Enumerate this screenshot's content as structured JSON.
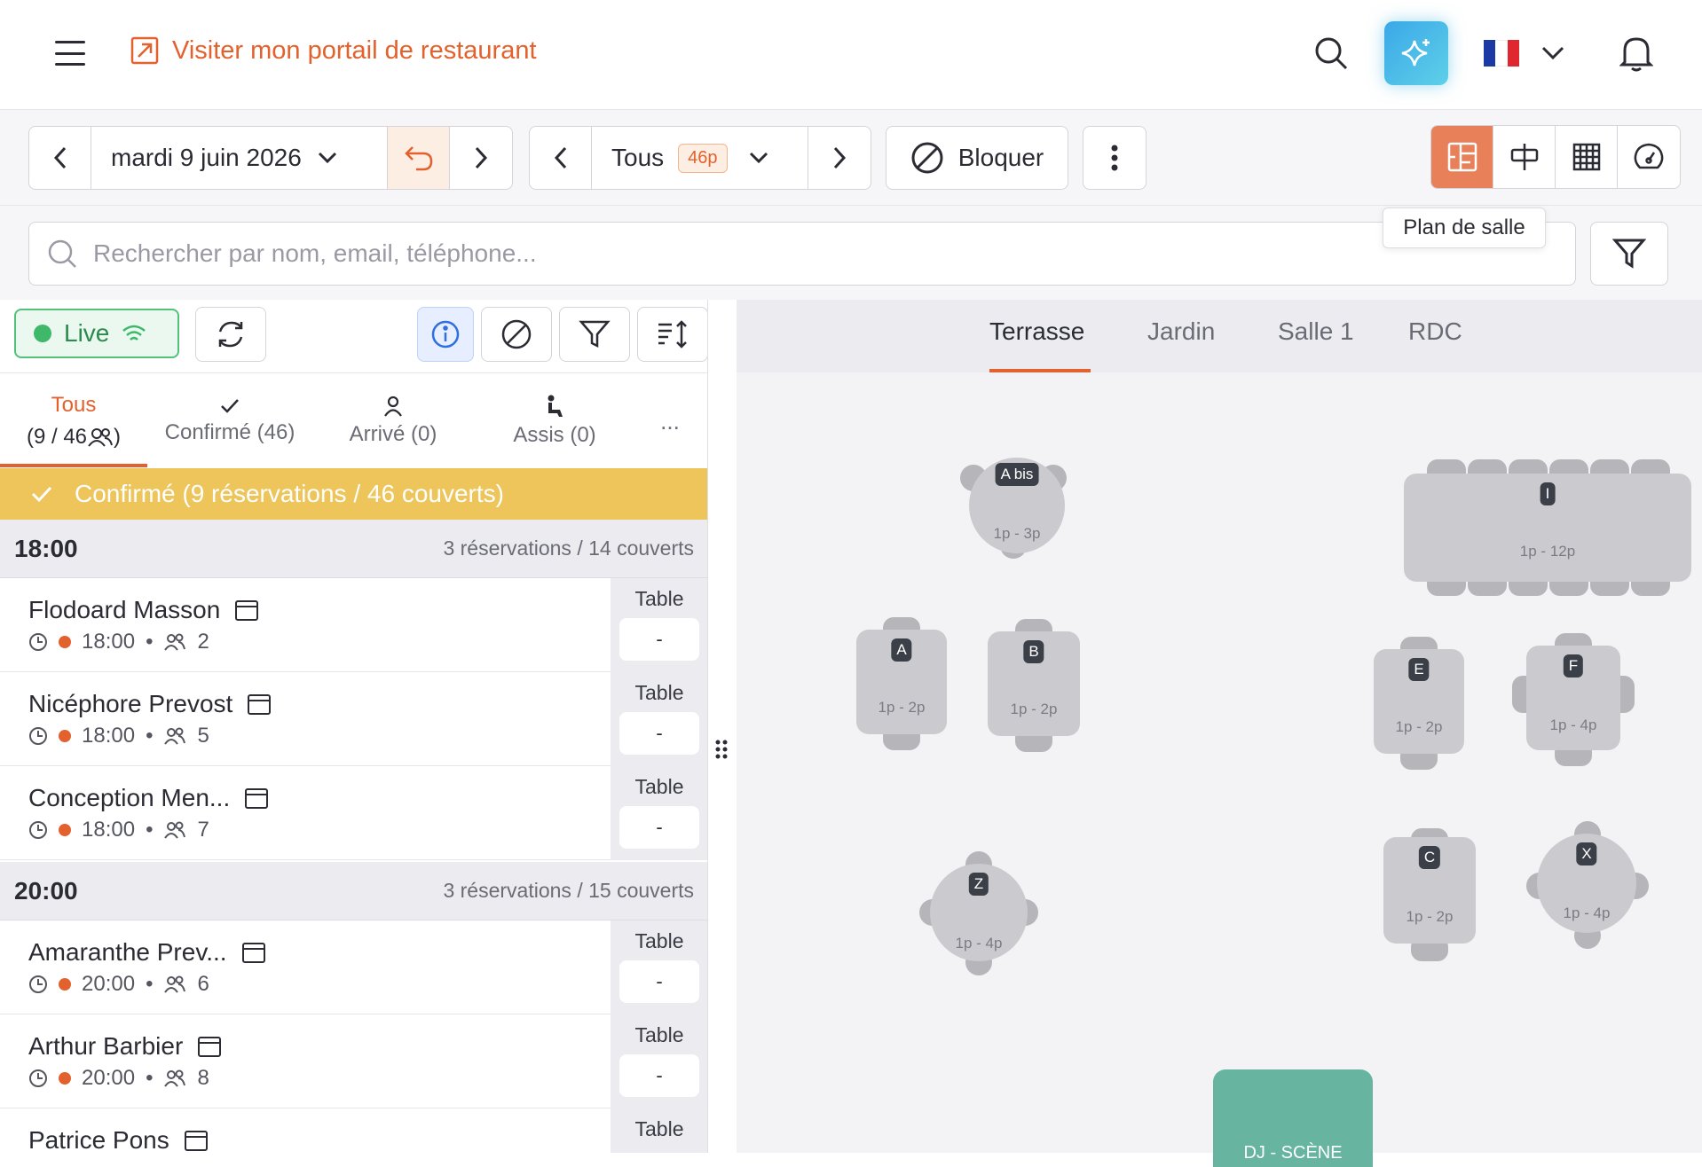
{
  "header": {
    "portal_link": "Visiter mon portail de restaurant",
    "language_flag": "fr-flag"
  },
  "toolbar": {
    "date": "mardi 9 juin 2026",
    "service_filter": "Tous",
    "service_badge": "46p",
    "block_label": "Bloquer",
    "view_tooltip": "Plan de salle"
  },
  "search": {
    "placeholder": "Rechercher par nom, email, téléphone..."
  },
  "left": {
    "live_label": "Live",
    "tabs": [
      {
        "label": "Tous",
        "sub": "(9 / 46"
      },
      {
        "label": "Confirmé (46)"
      },
      {
        "label": "Arrivé (0)"
      },
      {
        "label": "Assis (0)"
      },
      {
        "label": "..."
      }
    ],
    "banner": "Confirmé (9 réservations / 46 couverts)",
    "sections": [
      {
        "time": "18:00",
        "info": "3 réservations / 14 couverts"
      },
      {
        "time": "20:00",
        "info": "3 réservations / 15 couverts"
      }
    ],
    "reservations": [
      {
        "name": "Flodoard Masson",
        "time": "18:00",
        "guests": "2",
        "table_label": "Table",
        "table": "-"
      },
      {
        "name": "Nicéphore Prevost",
        "time": "18:00",
        "guests": "5",
        "table_label": "Table",
        "table": "-"
      },
      {
        "name": "Conception Men...",
        "time": "18:00",
        "guests": "7",
        "table_label": "Table",
        "table": "-"
      },
      {
        "name": "Amaranthe Prev...",
        "time": "20:00",
        "guests": "6",
        "table_label": "Table",
        "table": "-"
      },
      {
        "name": "Arthur Barbier",
        "time": "20:00",
        "guests": "8",
        "table_label": "Table",
        "table": "-"
      },
      {
        "name": "Patrice Pons",
        "table_label": "Table"
      }
    ]
  },
  "floor": {
    "rooms": [
      "Terrasse",
      "Jardin",
      "Salle 1",
      "RDC"
    ],
    "active_room": "Terrasse",
    "tables": [
      {
        "label": "A bis",
        "capacity": "1p - 3p"
      },
      {
        "label": "I",
        "capacity": "1p - 12p"
      },
      {
        "label": "A",
        "capacity": "1p - 2p"
      },
      {
        "label": "B",
        "capacity": "1p - 2p"
      },
      {
        "label": "E",
        "capacity": "1p - 2p"
      },
      {
        "label": "F",
        "capacity": "1p - 4p"
      },
      {
        "label": "Z",
        "capacity": "1p - 4p"
      },
      {
        "label": "C",
        "capacity": "1p - 2p"
      },
      {
        "label": "X",
        "capacity": "1p - 4p"
      }
    ],
    "stage_label": "DJ - SCÈNE"
  },
  "colors": {
    "accent": "#e2612c",
    "live_green": "#3fb86a",
    "banner_yellow": "#eec55a",
    "stage_green": "#67b5a0"
  }
}
